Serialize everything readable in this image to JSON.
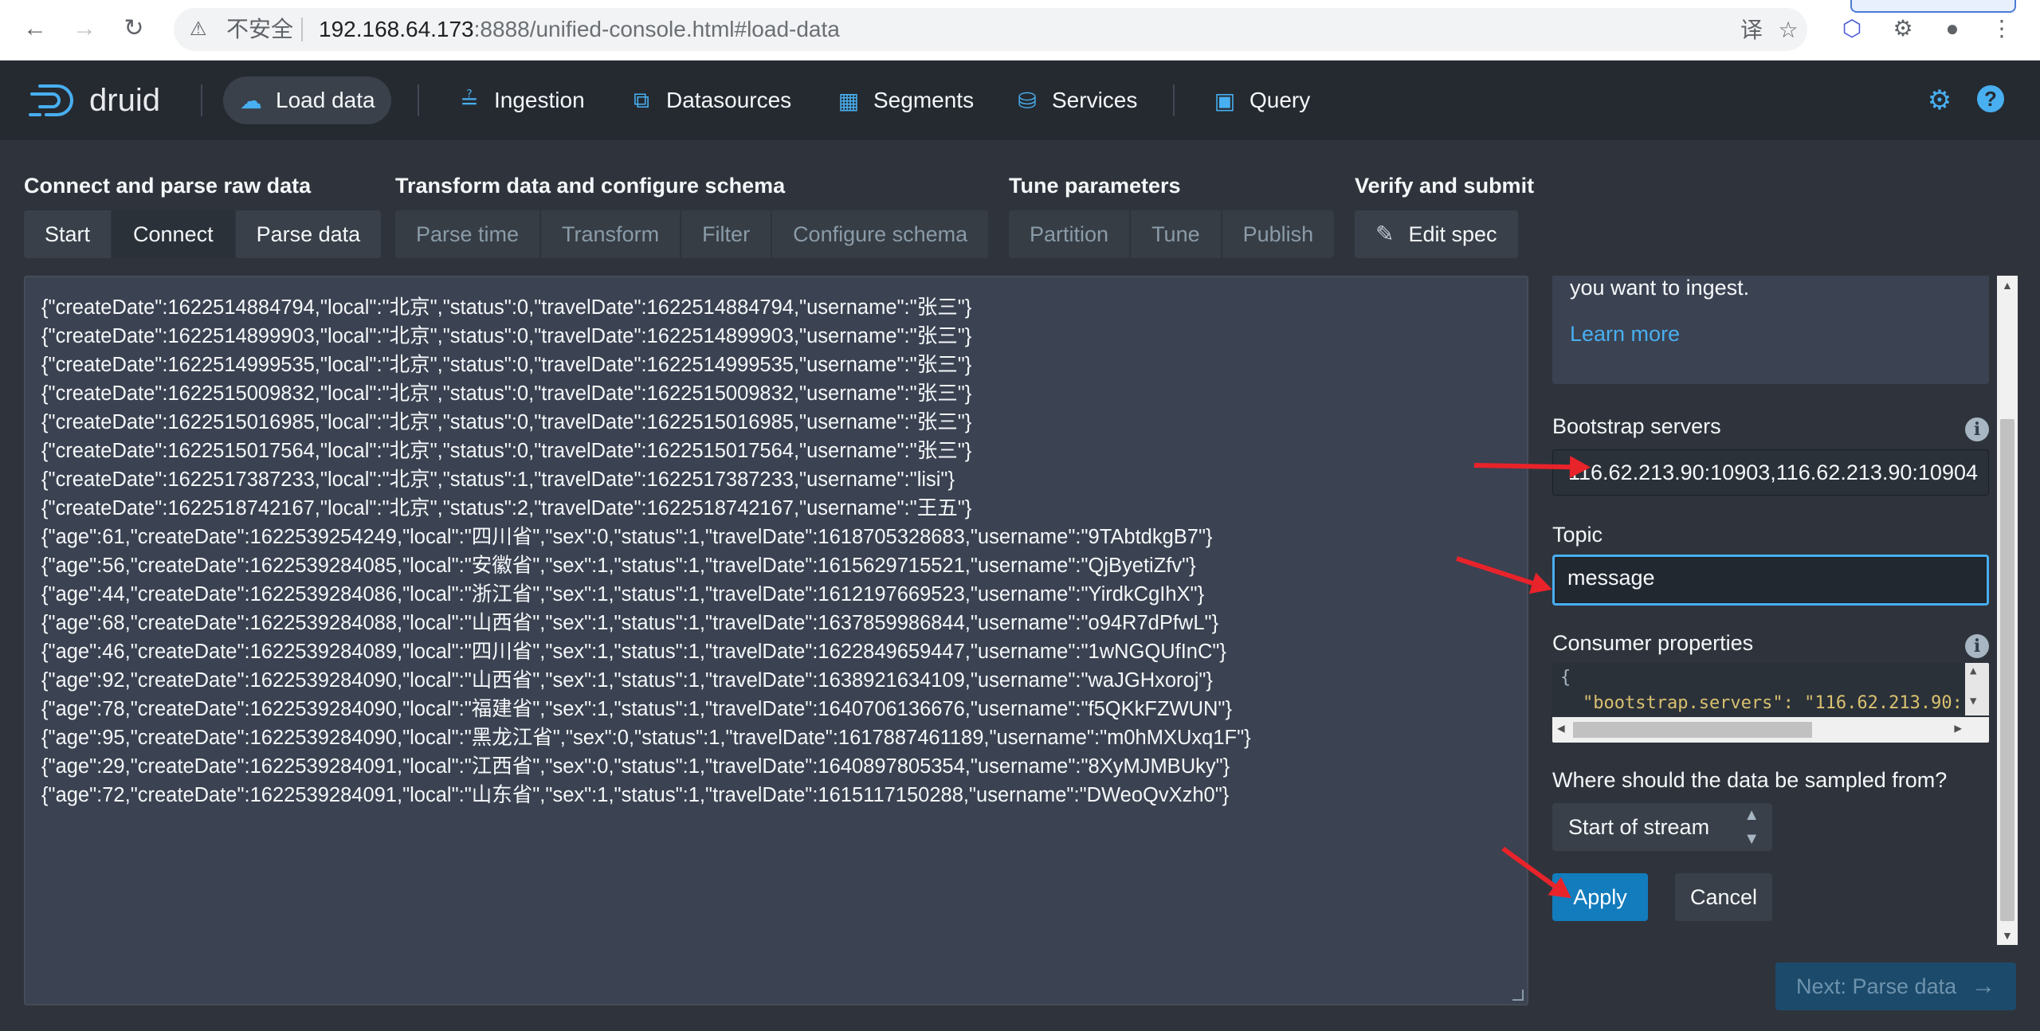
{
  "browser": {
    "security_label": "不安全",
    "url_host": "192.168.64.173",
    "url_rest": ":8888/unified-console.html#load-data"
  },
  "nav": {
    "logo_text": "druid",
    "items": [
      {
        "label": "Load data",
        "icon": "cloud-upload-icon"
      },
      {
        "label": "Ingestion",
        "icon": "ingestion-icon"
      },
      {
        "label": "Datasources",
        "icon": "datasources-icon"
      },
      {
        "label": "Segments",
        "icon": "segments-icon"
      },
      {
        "label": "Services",
        "icon": "database-icon"
      },
      {
        "label": "Query",
        "icon": "query-icon"
      }
    ]
  },
  "steps": {
    "group1": {
      "title": "Connect and parse raw data",
      "buttons": [
        "Start",
        "Connect",
        "Parse data"
      ]
    },
    "group2": {
      "title": "Transform data and configure schema",
      "buttons": [
        "Parse time",
        "Transform",
        "Filter",
        "Configure schema"
      ]
    },
    "group3": {
      "title": "Tune parameters",
      "buttons": [
        "Partition",
        "Tune",
        "Publish"
      ]
    },
    "group4": {
      "title": "Verify and submit",
      "buttons": [
        "Edit spec"
      ]
    }
  },
  "raw_lines": [
    "{\"createDate\":1622514884794,\"local\":\"北京\",\"status\":0,\"travelDate\":1622514884794,\"username\":\"张三\"}",
    "{\"createDate\":1622514899903,\"local\":\"北京\",\"status\":0,\"travelDate\":1622514899903,\"username\":\"张三\"}",
    "{\"createDate\":1622514999535,\"local\":\"北京\",\"status\":0,\"travelDate\":1622514999535,\"username\":\"张三\"}",
    "{\"createDate\":1622515009832,\"local\":\"北京\",\"status\":0,\"travelDate\":1622515009832,\"username\":\"张三\"}",
    "{\"createDate\":1622515016985,\"local\":\"北京\",\"status\":0,\"travelDate\":1622515016985,\"username\":\"张三\"}",
    "{\"createDate\":1622515017564,\"local\":\"北京\",\"status\":0,\"travelDate\":1622515017564,\"username\":\"张三\"}",
    "{\"createDate\":1622517387233,\"local\":\"北京\",\"status\":1,\"travelDate\":1622517387233,\"username\":\"lisi\"}",
    "{\"createDate\":1622518742167,\"local\":\"北京\",\"status\":2,\"travelDate\":1622518742167,\"username\":\"王五\"}",
    "{\"age\":61,\"createDate\":1622539254249,\"local\":\"四川省\",\"sex\":0,\"status\":1,\"travelDate\":1618705328683,\"username\":\"9TAbtdkgB7\"}",
    "{\"age\":56,\"createDate\":1622539284085,\"local\":\"安徽省\",\"sex\":1,\"status\":1,\"travelDate\":1615629715521,\"username\":\"QjByetiZfv\"}",
    "{\"age\":44,\"createDate\":1622539284086,\"local\":\"浙江省\",\"sex\":1,\"status\":1,\"travelDate\":1612197669523,\"username\":\"YirdkCgIhX\"}",
    "{\"age\":68,\"createDate\":1622539284088,\"local\":\"山西省\",\"sex\":1,\"status\":1,\"travelDate\":1637859986844,\"username\":\"o94R7dPfwL\"}",
    "{\"age\":46,\"createDate\":1622539284089,\"local\":\"四川省\",\"sex\":1,\"status\":1,\"travelDate\":1622849659447,\"username\":\"1wNGQUfInC\"}",
    "{\"age\":92,\"createDate\":1622539284090,\"local\":\"山西省\",\"sex\":1,\"status\":1,\"travelDate\":1638921634109,\"username\":\"waJGHxoroj\"}",
    "{\"age\":78,\"createDate\":1622539284090,\"local\":\"福建省\",\"sex\":1,\"status\":1,\"travelDate\":1640706136676,\"username\":\"f5QKkFZWUN\"}",
    "{\"age\":95,\"createDate\":1622539284090,\"local\":\"黑龙江省\",\"sex\":0,\"status\":1,\"travelDate\":1617887461189,\"username\":\"m0hMXUxq1F\"}",
    "{\"age\":29,\"createDate\":1622539284091,\"local\":\"江西省\",\"sex\":0,\"status\":1,\"travelDate\":1640897805354,\"username\":\"8XyMJMBUky\"}",
    "{\"age\":72,\"createDate\":1622539284091,\"local\":\"山东省\",\"sex\":1,\"status\":1,\"travelDate\":1615117150288,\"username\":\"DWeoQvXzh0\"}"
  ],
  "sidebar": {
    "callout_text": "you want to ingest.",
    "learn_more": "Learn more",
    "bootstrap_label": "Bootstrap servers",
    "bootstrap_value": "116.62.213.90:10903,116.62.213.90:10904",
    "topic_label": "Topic",
    "topic_value": "message",
    "consumer_label": "Consumer properties",
    "consumer_line1": "{",
    "consumer_line2": "\"bootstrap.servers\": \"116.62.213.90:",
    "sample_label": "Where should the data be sampled from?",
    "sample_value": "Start of stream",
    "apply": "Apply",
    "cancel": "Cancel"
  },
  "footer": {
    "next": "Next: Parse data"
  },
  "colors": {
    "accent": "#48aff0",
    "primary": "#137cbd",
    "annotation": "#e8232a"
  }
}
